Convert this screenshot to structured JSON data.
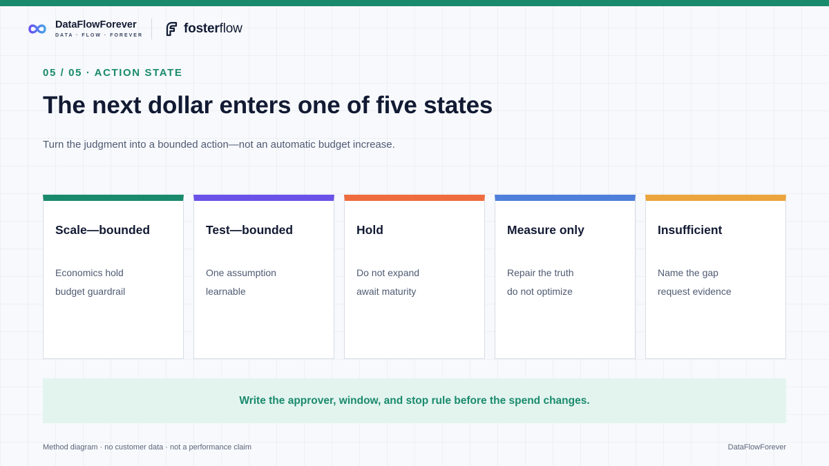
{
  "colors": {
    "accent": "#1a8a6c",
    "ink": "#121a33",
    "muted": "#4f5a72",
    "callout_bg": "#e3f4ef",
    "logo_gradient_start": "#6a4ff0",
    "logo_gradient_end": "#4aa3e8"
  },
  "header": {
    "brand_name": "DataFlowForever",
    "brand_tagline": "DATA · FLOW · FOREVER",
    "logo_icon": "infinity-icon",
    "partner_icon": "fosterflow-logo-icon",
    "partner_name_strong": "foster",
    "partner_name_light": "flow"
  },
  "eyebrow": "05 / 05 · ACTION STATE",
  "title": "The next dollar enters one of five states",
  "subtitle": "Turn the judgment into a bounded action—not an automatic budget increase.",
  "cards": [
    {
      "title": "Scale—bounded",
      "line1": "Economics hold",
      "line2": "budget guardrail",
      "color": "#1a8a6c"
    },
    {
      "title": "Test—bounded",
      "line1": "One assumption",
      "line2": "learnable",
      "color": "#6a52e8"
    },
    {
      "title": "Hold",
      "line1": "Do not expand",
      "line2": "await maturity",
      "color": "#ef6c3e"
    },
    {
      "title": "Measure only",
      "line1": "Repair the truth",
      "line2": "do not optimize",
      "color": "#4f7fdb"
    },
    {
      "title": "Insufficient",
      "line1": "Name the gap",
      "line2": "request evidence",
      "color": "#eba53c"
    }
  ],
  "callout": "Write the approver, window, and stop rule before the spend changes.",
  "footer": {
    "left": "Method diagram · no customer data · not a performance claim",
    "right": "DataFlowForever"
  }
}
